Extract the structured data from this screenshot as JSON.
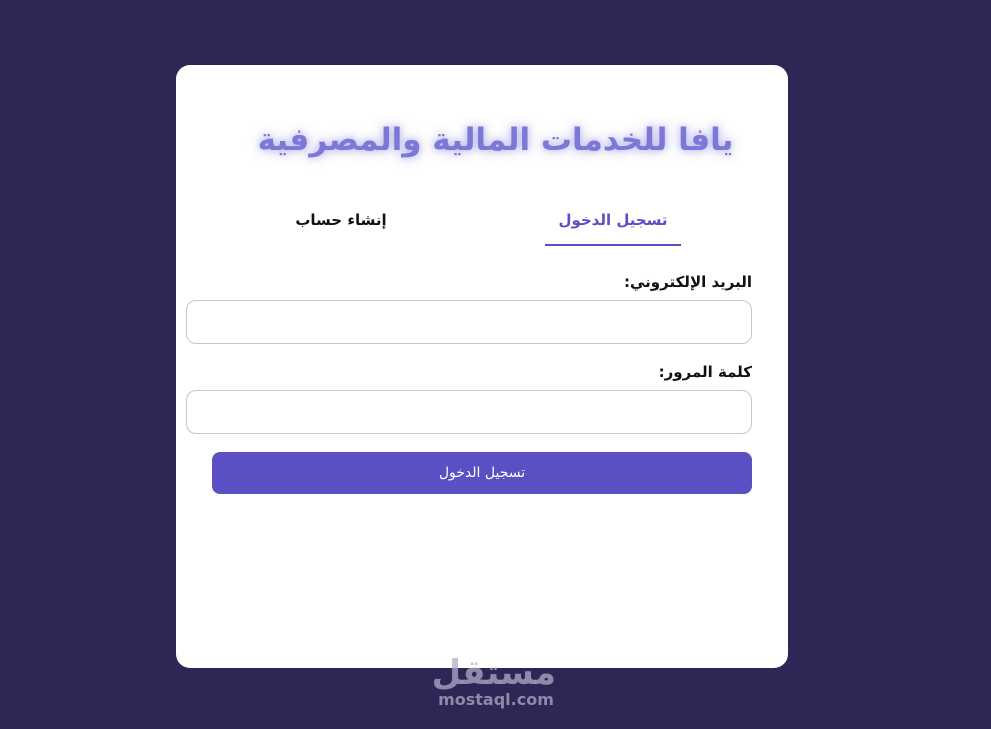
{
  "header": {
    "title": "يافا للخدمات المالية والمصرفية"
  },
  "tabs": {
    "login_label": "تسجيل الدخول",
    "signup_label": "إنشاء حساب",
    "active": "login"
  },
  "form": {
    "email_label": "البريد الإلكتروني:",
    "email_value": "",
    "password_label": "كلمة المرور:",
    "password_value": "",
    "submit_label": "تسجيل الدخول"
  },
  "watermark": {
    "logo_text": "مستقل",
    "url": "mostaql.com"
  },
  "colors": {
    "page_background": "#2e2654",
    "accent": "#5b4fc4",
    "title": "#7b78d8"
  }
}
